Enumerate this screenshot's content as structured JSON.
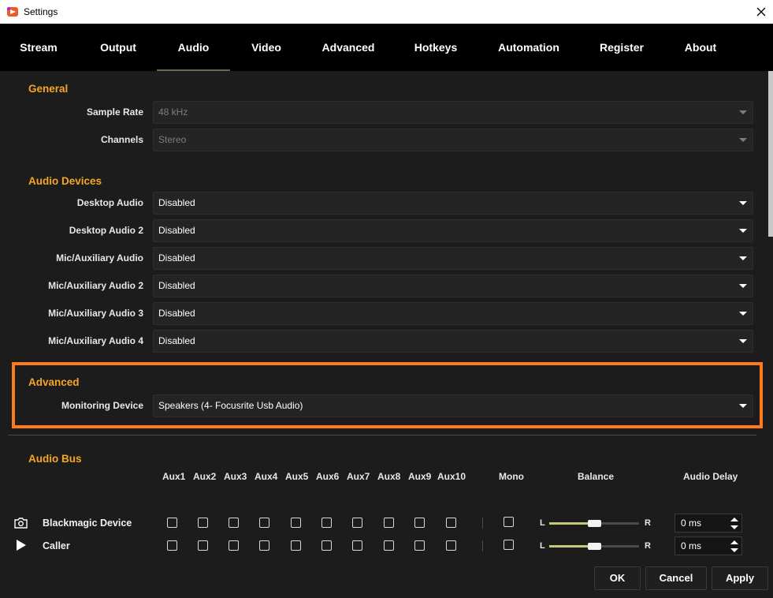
{
  "window": {
    "title": "Settings"
  },
  "tabs": [
    {
      "label": "Stream"
    },
    {
      "label": "Output"
    },
    {
      "label": "Audio",
      "active": true
    },
    {
      "label": "Video"
    },
    {
      "label": "Advanced"
    },
    {
      "label": "Hotkeys"
    },
    {
      "label": "Automation"
    },
    {
      "label": "Register"
    },
    {
      "label": "About"
    }
  ],
  "general": {
    "title": "General",
    "sample_rate": {
      "label": "Sample Rate",
      "value": "48 kHz"
    },
    "channels": {
      "label": "Channels",
      "value": "Stereo"
    }
  },
  "audio_devices": {
    "title": "Audio Devices",
    "items": [
      {
        "label": "Desktop Audio",
        "value": "Disabled"
      },
      {
        "label": "Desktop Audio 2",
        "value": "Disabled"
      },
      {
        "label": "Mic/Auxiliary Audio",
        "value": "Disabled"
      },
      {
        "label": "Mic/Auxiliary Audio 2",
        "value": "Disabled"
      },
      {
        "label": "Mic/Auxiliary Audio 3",
        "value": "Disabled"
      },
      {
        "label": "Mic/Auxiliary Audio 4",
        "value": "Disabled"
      }
    ]
  },
  "advanced": {
    "title": "Advanced",
    "monitoring_device": {
      "label": "Monitoring Device",
      "value": "Speakers (4- Focusrite Usb Audio)"
    }
  },
  "audio_bus": {
    "title": "Audio Bus",
    "aux_headers": [
      "Aux1",
      "Aux2",
      "Aux3",
      "Aux4",
      "Aux5",
      "Aux6",
      "Aux7",
      "Aux8",
      "Aux9",
      "Aux10"
    ],
    "mono_header": "Mono",
    "balance_header": "Balance",
    "delay_header": "Audio Delay",
    "balance_left": "L",
    "balance_right": "R",
    "rows": [
      {
        "name": "Blackmagic Device",
        "icon": "camera-icon",
        "balance": 0.5,
        "delay": "0 ms"
      },
      {
        "name": "Caller",
        "icon": "play-icon",
        "balance": 0.5,
        "delay": "0 ms"
      }
    ]
  },
  "buttons": {
    "ok": "OK",
    "cancel": "Cancel",
    "apply": "Apply"
  },
  "colors": {
    "section_title": "#f5a623",
    "highlight_border": "#ff7a1a",
    "balance_fill": "#c6c978"
  }
}
